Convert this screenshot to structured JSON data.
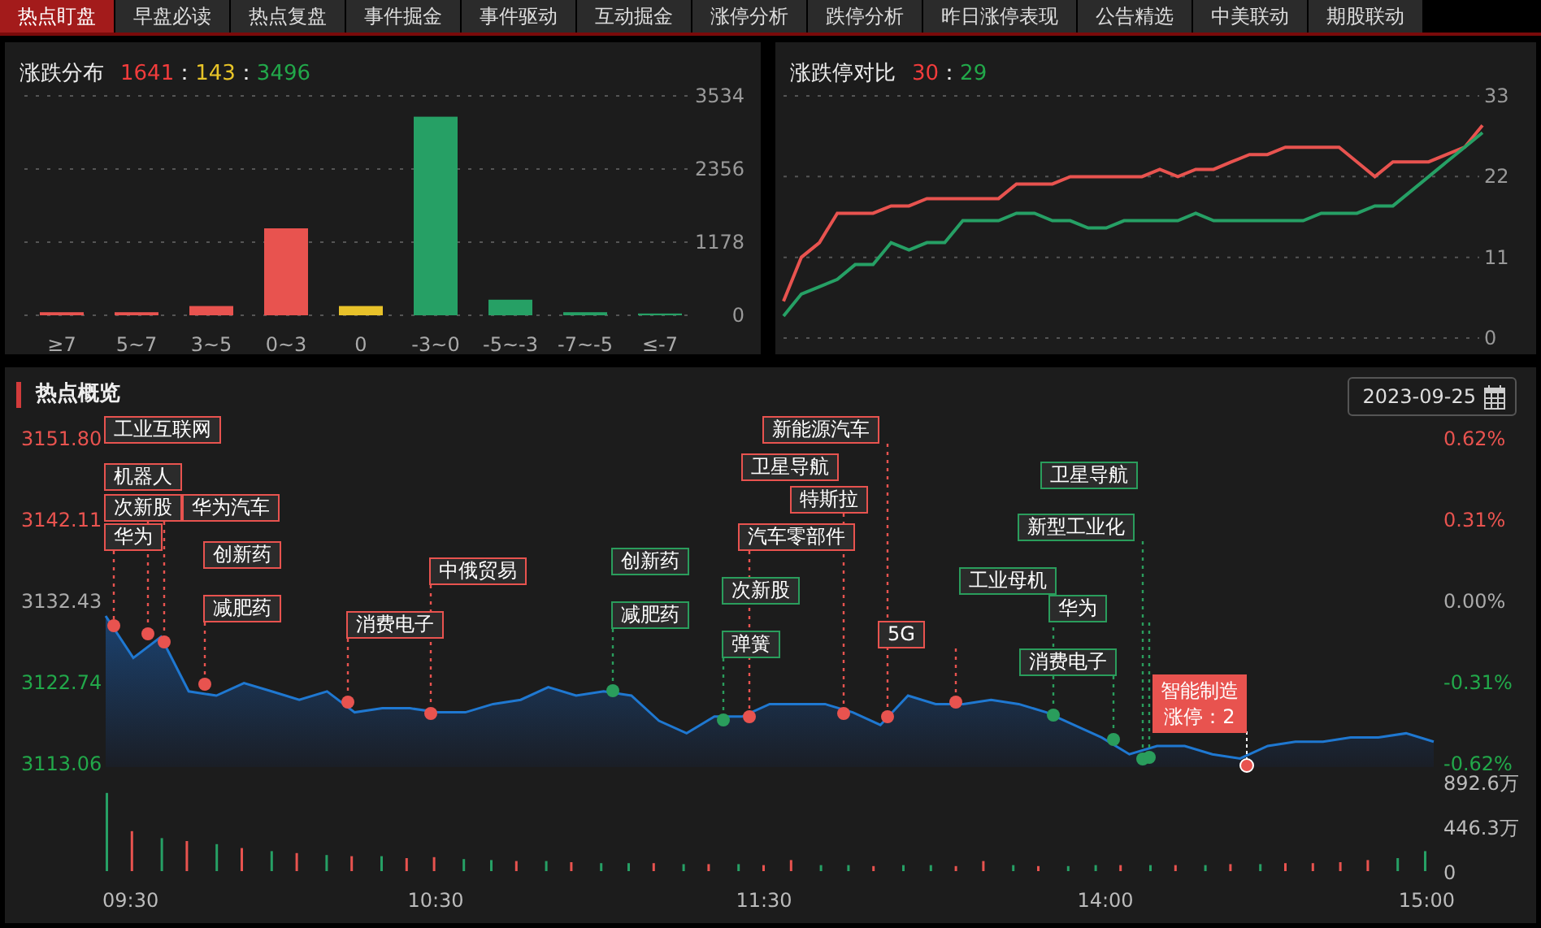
{
  "tabs": [
    {
      "label": "热点盯盘",
      "selected": true
    },
    {
      "label": "早盘必读",
      "selected": false
    },
    {
      "label": "热点复盘",
      "selected": false
    },
    {
      "label": "事件掘金",
      "selected": false
    },
    {
      "label": "事件驱动",
      "selected": false
    },
    {
      "label": "互动掘金",
      "selected": false
    },
    {
      "label": "涨停分析",
      "selected": false
    },
    {
      "label": "跌停分析",
      "selected": false
    },
    {
      "label": "昨日涨停表现",
      "selected": false
    },
    {
      "label": "公告精选",
      "selected": false
    },
    {
      "label": "中美联动",
      "selected": false
    },
    {
      "label": "期股联动",
      "selected": false
    }
  ],
  "rise_fall_distribution": {
    "title": "涨跌分布",
    "separator": "：",
    "counts": [
      {
        "value": "1641",
        "color": "#f23c3c"
      },
      {
        "value": "143",
        "color": "#e8c428"
      },
      {
        "value": "3496",
        "color": "#22a84a"
      }
    ],
    "chart_data": {
      "type": "bar",
      "categories": [
        "≥7",
        "5~7",
        "3~5",
        "0~3",
        "0",
        "-3~0",
        "-5~-3",
        "-7~-5",
        "≤-7"
      ],
      "stacked": true,
      "ylim": [
        0,
        3534
      ],
      "yticks": [
        0,
        1178,
        2356,
        3534
      ],
      "series": [
        {
          "color": "#e8534f",
          "values": [
            50,
            50,
            150,
            1400,
            null,
            null,
            null,
            null,
            null
          ]
        },
        {
          "color": "#e8c22a",
          "values": [
            null,
            null,
            null,
            null,
            150,
            null,
            null,
            null,
            null
          ]
        },
        {
          "color": "#26a065",
          "values": [
            null,
            null,
            null,
            null,
            null,
            3200,
            250,
            50,
            30
          ]
        }
      ]
    }
  },
  "limit_comparison": {
    "title": "涨跌停对比",
    "separator": "：",
    "counts": [
      {
        "value": "30",
        "color": "#f23c3c"
      },
      {
        "value": "29",
        "color": "#22a84a"
      }
    ],
    "chart_data": {
      "type": "line",
      "ylim": [
        0,
        33
      ],
      "yticks": [
        0,
        11,
        22,
        33
      ],
      "series": [
        {
          "color": "#e8534f",
          "values": [
            5,
            11,
            13,
            17,
            17,
            17,
            18,
            18,
            19,
            19,
            19,
            19,
            19,
            21,
            21,
            21,
            22,
            22,
            22,
            22,
            22,
            23,
            22,
            23,
            23,
            24,
            25,
            25,
            26,
            26,
            26,
            26,
            24,
            22,
            24,
            24,
            24,
            25,
            26,
            29
          ]
        },
        {
          "color": "#26a065",
          "values": [
            3,
            6,
            7,
            8,
            10,
            10,
            13,
            12,
            13,
            13,
            16,
            16,
            16,
            17,
            17,
            16,
            16,
            15,
            15,
            16,
            16,
            16,
            16,
            17,
            16,
            16,
            16,
            16,
            16,
            16,
            17,
            17,
            17,
            18,
            18,
            20,
            22,
            24,
            26,
            28
          ]
        }
      ]
    }
  },
  "hot_overview": {
    "title": "热点概览",
    "date": "2023-09-25",
    "right_axis_labels": [
      "0.62%",
      "0.31%",
      "0.00%",
      "-0.31%",
      "-0.62%"
    ],
    "chart_data": {
      "type": "area",
      "ylim": [
        3113.06,
        3151.8
      ],
      "yticks": [
        {
          "value": 3151.8,
          "label": "3151.80"
        },
        {
          "value": 3142.11,
          "label": "3142.11"
        },
        {
          "value": 3132.43,
          "label": "3132.43"
        },
        {
          "value": 3122.74,
          "label": "3122.74"
        },
        {
          "value": 3113.06,
          "label": "3113.06"
        }
      ],
      "series": [
        {
          "color": "#1f78d1",
          "values": [
            3130.5,
            3125.5,
            3128,
            3121.5,
            3121,
            3122.5,
            3121.5,
            3120.5,
            3121.5,
            3119,
            3119.5,
            3119.5,
            3119,
            3119,
            3120,
            3120.5,
            3122,
            3121,
            3121.5,
            3121,
            3118,
            3116.5,
            3118.5,
            3118.5,
            3120,
            3120,
            3120,
            3119,
            3117.5,
            3121,
            3120,
            3120,
            3120.5,
            3120,
            3119,
            3117.5,
            3116,
            3114,
            3115,
            3115,
            3114,
            3113.5,
            3115,
            3115.5,
            3115.5,
            3116,
            3116,
            3116.5,
            3115.5
          ]
        }
      ]
    },
    "time_labels": [
      "09:30",
      "10:30",
      "11:30",
      "14:00",
      "15:00"
    ],
    "volume": {
      "chart_data": {
        "type": "bar",
        "stacked": false,
        "ylim": [
          0,
          892.6
        ],
        "yticks": [
          {
            "value": 0,
            "label": "0"
          },
          {
            "value": 446.3,
            "label": "446.3万"
          },
          {
            "value": 892.6,
            "label": "892.6万"
          }
        ],
        "series": [
          {
            "color": "#e8534f",
            "values": [
              null,
              400,
              null,
              300,
              null,
              230,
              null,
              180,
              null,
              150,
              null,
              130,
              140,
              null,
              null,
              100,
              null,
              90,
              null,
              null,
              80,
              null,
              70,
              null,
              60,
              110,
              null,
              null,
              50,
              null,
              null,
              50,
              100,
              null,
              50,
              null,
              null,
              60,
              null,
              60,
              null,
              70,
              null,
              80,
              80,
              90,
              110,
              null,
              null
            ]
          },
          {
            "color": "#26a065",
            "values": [
              780,
              null,
              330,
              null,
              270,
              null,
              200,
              null,
              160,
              null,
              150,
              null,
              null,
              120,
              110,
              null,
              100,
              null,
              80,
              80,
              null,
              70,
              null,
              70,
              null,
              null,
              60,
              60,
              null,
              60,
              60,
              null,
              null,
              60,
              null,
              50,
              60,
              null,
              60,
              null,
              60,
              null,
              70,
              null,
              null,
              null,
              null,
              130,
              200
            ]
          }
        ]
      }
    },
    "tags": [
      {
        "label": "工业互联网",
        "color": "#e8534f"
      },
      {
        "label": "机器人",
        "color": "#e8534f"
      },
      {
        "label": "次新股",
        "color": "#e8534f"
      },
      {
        "label": "华为汽车",
        "color": "#e8534f"
      },
      {
        "label": "华为",
        "color": "#e8534f"
      },
      {
        "label": "创新药",
        "color": "#e8534f"
      },
      {
        "label": "减肥药",
        "color": "#e8534f"
      },
      {
        "label": "消费电子",
        "color": "#e8534f"
      },
      {
        "label": "中俄贸易",
        "color": "#e8534f"
      },
      {
        "label": "创新药",
        "color": "#2a9d5c"
      },
      {
        "label": "减肥药",
        "color": "#2a9d5c"
      },
      {
        "label": "新能源汽车",
        "color": "#e8534f"
      },
      {
        "label": "卫星导航",
        "color": "#e8534f"
      },
      {
        "label": "特斯拉",
        "color": "#e8534f"
      },
      {
        "label": "汽车零部件",
        "color": "#e8534f"
      },
      {
        "label": "次新股",
        "color": "#2a9d5c"
      },
      {
        "label": "弹簧",
        "color": "#2a9d5c"
      },
      {
        "label": "5G",
        "color": "#e8534f"
      },
      {
        "label": "卫星导航",
        "color": "#2a9d5c"
      },
      {
        "label": "新型工业化",
        "color": "#2a9d5c"
      },
      {
        "label": "工业母机",
        "color": "#2a9d5c"
      },
      {
        "label": "华为",
        "color": "#2a9d5c"
      },
      {
        "label": "消费电子",
        "color": "#2a9d5c"
      }
    ],
    "tooltip": {
      "title": "智能制造",
      "detail": "涨停：2"
    }
  }
}
